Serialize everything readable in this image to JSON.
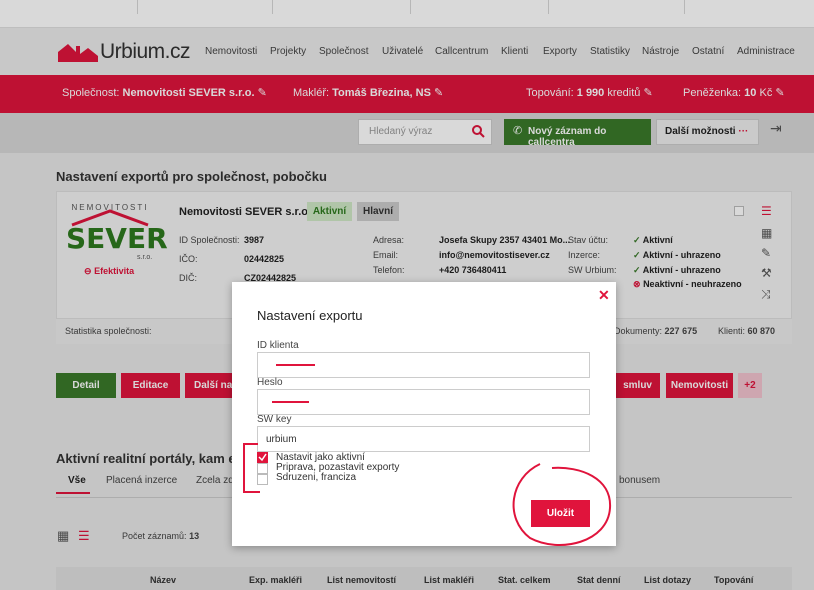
{
  "app": {
    "logo": "Urbium.cz"
  },
  "nav": [
    "Nemovitosti",
    "Projekty",
    "Společnost",
    "Uživatelé",
    "Callcentrum",
    "Klienti",
    "Exporty",
    "Statistiky",
    "Nástroje",
    "Ostatní",
    "Administrace"
  ],
  "redbar": {
    "company_label": "Společnost:",
    "company": "Nemovitosti SEVER s.r.o.",
    "agent_label": "Makléř:",
    "agent": "Tomáš Březina, NS",
    "top_label": "Topování:",
    "top_value": "1 990",
    "top_unit": "kreditů",
    "wallet_label": "Peněženka:",
    "wallet_value": "10",
    "wallet_unit": "Kč"
  },
  "toolbar": {
    "search_placeholder": "Hledaný výraz",
    "new_record": "Nový záznam do callcentra",
    "more": "Další možnosti"
  },
  "page": {
    "title": "Nastavení exportů pro společnost, pobočku"
  },
  "company": {
    "logo_top": "NEMOVITOSTI",
    "logo_main": "SEVER",
    "logo_sub": "s.r.o.",
    "efektivita": "Efektivita",
    "name": "Nemovitosti SEVER s.r.o.",
    "badge_active": "Aktivní",
    "badge_main": "Hlavní",
    "id_label": "ID Společnosti:",
    "id": "3987",
    "ico_label": "IČO:",
    "ico": "02442825",
    "dic_label": "DIČ:",
    "dic": "CZ02442825",
    "address_label": "Adresa:",
    "address": "Josefa Skupy 2357 43401 Mo...",
    "email_label": "Email:",
    "email": "info@nemovitostisever.cz",
    "phone_label": "Telefon:",
    "phone": "+420 736480411",
    "acct_label": "Stav účtu:",
    "acct": "Aktivní",
    "ads_label": "Inzerce:",
    "ads": "Aktivní - uhrazeno",
    "sw_label": "SW Urbium:",
    "sw": "Aktivní - uhrazeno",
    "other_val": "Neaktivní - neuhrazeno",
    "stats_label": "Statistika společnosti:",
    "docs_label": "Dokumenty:",
    "docs": "227 675",
    "clients_label": "Klienti:",
    "clients": "60 870"
  },
  "actions": {
    "detail": "Detail",
    "edit": "Editace",
    "more": "Další nas",
    "contracts": "smluv",
    "properties": "Nemovitosti",
    "plus": "+2"
  },
  "portals": {
    "title": "Aktivní realitní portály, kam e",
    "tabs": [
      "Vše",
      "Placená inzerce",
      "Zcela zd",
      "bonusem"
    ],
    "count_label": "Počet záznamů:",
    "count": "13"
  },
  "table": {
    "headers": [
      "Název",
      "Exp. makléři",
      "List nemovitostí",
      "List makléři",
      "Stat. celkem",
      "Stat denní",
      "List dotazy",
      "Topování"
    ]
  },
  "dialog": {
    "title": "Nastavení exportu",
    "client_id_label": "ID klienta",
    "password_label": "Heslo",
    "swkey_label": "SW key",
    "swkey_value": "urbium",
    "checks": [
      {
        "label": "Nastavit jako aktivní",
        "checked": true
      },
      {
        "label": "Priprava, pozastavit exporty",
        "checked": false
      },
      {
        "label": "Sdruzeni, franciza",
        "checked": false
      }
    ],
    "save": "Uložit"
  },
  "colors": {
    "brand": "#e0143c",
    "green": "#3a7a2a"
  }
}
